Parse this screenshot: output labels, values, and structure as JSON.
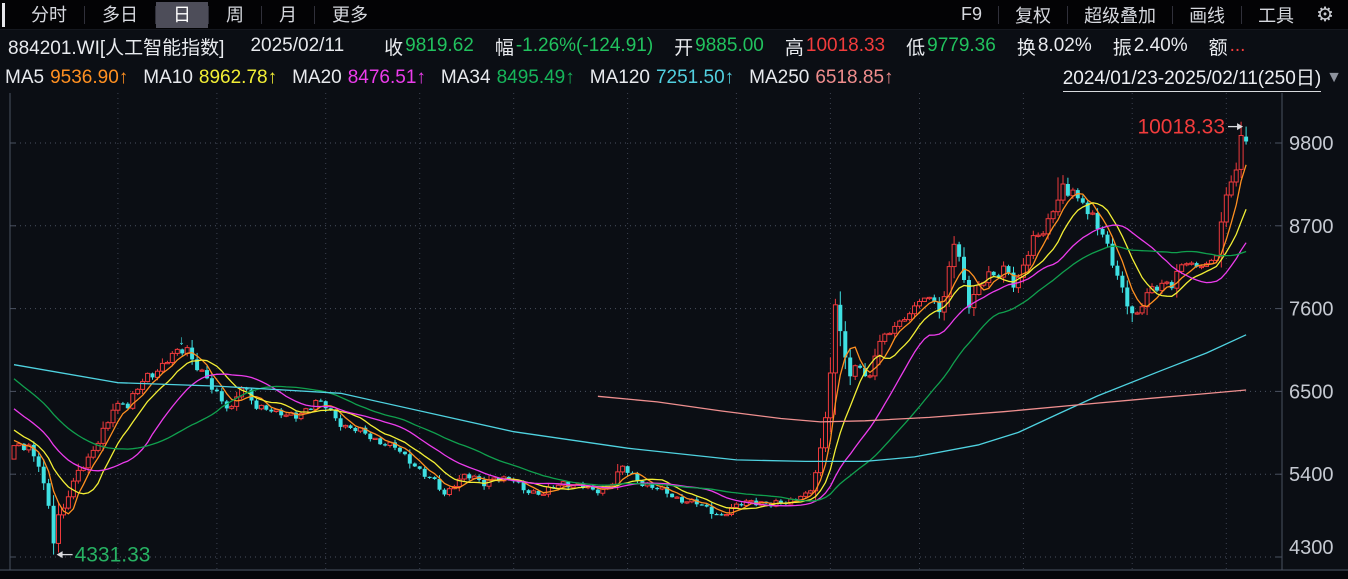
{
  "toolbar": {
    "left_tabs": [
      {
        "label": "分时",
        "active": false
      },
      {
        "label": "多日",
        "active": false
      },
      {
        "label": "日",
        "active": true
      },
      {
        "label": "周",
        "active": false
      },
      {
        "label": "月",
        "active": false
      },
      {
        "label": "更多",
        "active": false
      }
    ],
    "right_items": [
      "F9",
      "复权",
      "超级叠加",
      "画线",
      "工具"
    ],
    "gear_icon": "⚙"
  },
  "info_bar": {
    "symbol": "884201.WI[人工智能指数]",
    "date": "2025/02/11",
    "fields": [
      {
        "label": "收",
        "value": "9819.62",
        "color": "#21c25e"
      },
      {
        "label": "幅",
        "value": "-1.26%(-124.91)",
        "color": "#21c25e"
      },
      {
        "label": "开",
        "value": "9885.00",
        "color": "#21c25e"
      },
      {
        "label": "高",
        "value": "10018.33",
        "color": "#f23c3c"
      },
      {
        "label": "低",
        "value": "9779.36",
        "color": "#21c25e"
      },
      {
        "label": "换",
        "value": "8.02%",
        "color": "#e8eaee"
      },
      {
        "label": "振",
        "value": "2.40%",
        "color": "#e8eaee"
      },
      {
        "label": "额",
        "value": "...",
        "color": "#f23c3c"
      }
    ]
  },
  "ma_bar": {
    "items": [
      {
        "label": "MA5",
        "value": "9536.90",
        "arrow": "↑",
        "color": "#ff9021"
      },
      {
        "label": "MA10",
        "value": "8962.78",
        "arrow": "↑",
        "color": "#f2ee35"
      },
      {
        "label": "MA20",
        "value": "8476.51",
        "arrow": "↑",
        "color": "#ec3cec"
      },
      {
        "label": "MA34",
        "value": "8495.49",
        "arrow": "↑",
        "color": "#16b45a"
      },
      {
        "label": "MA120",
        "value": "7251.50",
        "arrow": "↑",
        "color": "#52d0e0"
      },
      {
        "label": "MA250",
        "value": "6518.85",
        "arrow": "↑",
        "color": "#f08d8d"
      }
    ],
    "range_label": "2024/01/23-2025/02/11(250日)",
    "dropdown_icon": "▼"
  },
  "chart_data": {
    "type": "candlestick",
    "symbol": "884201.WI",
    "title": "人工智能指数 日K",
    "period_days": 250,
    "date_range": [
      "2024/01/23",
      "2025/02/11"
    ],
    "last_day": {
      "open": 9885.0,
      "high": 10018.33,
      "low": 9779.36,
      "close": 9819.62,
      "change_pct": -1.26,
      "change": -124.91
    },
    "y_axis": {
      "ticks": [
        9800,
        8700,
        7600,
        6500,
        5400,
        4300
      ],
      "grid": "dotted"
    },
    "annotations": {
      "high": {
        "text": "10018.33",
        "value": 10018.33,
        "day": 249,
        "color": "#f23c3c"
      },
      "low": {
        "text": "4331.33",
        "value": 4331.33,
        "day": 8,
        "color": "#27b263"
      }
    },
    "signal_marker": {
      "day": 34,
      "glyph": "↓",
      "color": "#3fe0e2"
    },
    "month_gridline_days": [
      21,
      41,
      63,
      82,
      101,
      124,
      146,
      165,
      183,
      204,
      226,
      245
    ],
    "colors": {
      "up": "#ee3a3c",
      "down": "#3fe0e2",
      "bg": "#0b0e14",
      "grid_h": "#49505f",
      "grid_v": "#3c4250",
      "axis": "#4a5160",
      "tick_label": "#c6cad2",
      "arrow": "#d9dade"
    },
    "ma_computed": [
      {
        "name": "MA5",
        "period": 5,
        "color": "#ff9021"
      },
      {
        "name": "MA10",
        "period": 10,
        "color": "#f2ee35"
      },
      {
        "name": "MA20",
        "period": 20,
        "color": "#ec3cec"
      },
      {
        "name": "MA34",
        "period": 34,
        "color": "#10a04e"
      }
    ],
    "ma_anchor_lines": [
      {
        "name": "MA120",
        "color": "#4fd2e0",
        "points": [
          [
            0,
            6855
          ],
          [
            21,
            6615
          ],
          [
            41,
            6570
          ],
          [
            66,
            6475
          ],
          [
            101,
            5965
          ],
          [
            124,
            5745
          ],
          [
            146,
            5590
          ],
          [
            160,
            5570
          ],
          [
            172,
            5570
          ],
          [
            182,
            5630
          ],
          [
            195,
            5790
          ],
          [
            203,
            5955
          ],
          [
            211,
            6200
          ],
          [
            219,
            6440
          ],
          [
            232,
            6780
          ],
          [
            241,
            7010
          ],
          [
            249,
            7251.5
          ]
        ]
      },
      {
        "name": "MA250",
        "color": "#ef8f8f",
        "points": [
          [
            118,
            6435
          ],
          [
            130,
            6360
          ],
          [
            143,
            6240
          ],
          [
            155,
            6140
          ],
          [
            163,
            6095
          ],
          [
            172,
            6110
          ],
          [
            185,
            6155
          ],
          [
            200,
            6230
          ],
          [
            215,
            6320
          ],
          [
            230,
            6410
          ],
          [
            240,
            6465
          ],
          [
            249,
            6518.85
          ]
        ]
      }
    ],
    "close_anchors": [
      [
        0,
        5780
      ],
      [
        2,
        5720
      ],
      [
        3,
        5760
      ],
      [
        4,
        5620
      ],
      [
        5,
        5500
      ],
      [
        6,
        5280
      ],
      [
        7,
        4980
      ],
      [
        8,
        4480
      ],
      [
        9,
        4860
      ],
      [
        10,
        4950
      ],
      [
        11,
        5120
      ],
      [
        12,
        5300
      ],
      [
        13,
        5480
      ],
      [
        15,
        5600
      ],
      [
        17,
        5800
      ],
      [
        19,
        6100
      ],
      [
        20,
        6300
      ],
      [
        22,
        6380
      ],
      [
        23,
        6280
      ],
      [
        25,
        6520
      ],
      [
        27,
        6720
      ],
      [
        29,
        6800
      ],
      [
        31,
        6900
      ],
      [
        33,
        7000
      ],
      [
        35,
        7090
      ],
      [
        36,
        6950
      ],
      [
        38,
        6750
      ],
      [
        40,
        6520
      ],
      [
        42,
        6380
      ],
      [
        44,
        6300
      ],
      [
        45,
        6450
      ],
      [
        46,
        6550
      ],
      [
        47,
        6450
      ],
      [
        49,
        6280
      ],
      [
        51,
        6320
      ],
      [
        53,
        6220
      ],
      [
        55,
        6150
      ],
      [
        57,
        6180
      ],
      [
        59,
        6280
      ],
      [
        61,
        6350
      ],
      [
        63,
        6280
      ],
      [
        65,
        6150
      ],
      [
        67,
        6050
      ],
      [
        69,
        5980
      ],
      [
        71,
        5920
      ],
      [
        73,
        5870
      ],
      [
        75,
        5820
      ],
      [
        77,
        5740
      ],
      [
        79,
        5620
      ],
      [
        81,
        5540
      ],
      [
        83,
        5400
      ],
      [
        85,
        5280
      ],
      [
        87,
        5120
      ],
      [
        89,
        5300
      ],
      [
        91,
        5380
      ],
      [
        93,
        5320
      ],
      [
        95,
        5280
      ],
      [
        97,
        5380
      ],
      [
        99,
        5320
      ],
      [
        101,
        5300
      ],
      [
        103,
        5220
      ],
      [
        105,
        5170
      ],
      [
        107,
        5120
      ],
      [
        109,
        5220
      ],
      [
        111,
        5300
      ],
      [
        113,
        5270
      ],
      [
        115,
        5220
      ],
      [
        117,
        5170
      ],
      [
        119,
        5220
      ],
      [
        121,
        5300
      ],
      [
        123,
        5470
      ],
      [
        125,
        5380
      ],
      [
        127,
        5300
      ],
      [
        129,
        5220
      ],
      [
        131,
        5170
      ],
      [
        133,
        5120
      ],
      [
        135,
        5070
      ],
      [
        137,
        5020
      ],
      [
        139,
        4970
      ],
      [
        141,
        4920
      ],
      [
        143,
        4860
      ],
      [
        145,
        4920
      ],
      [
        147,
        5000
      ],
      [
        149,
        5070
      ],
      [
        151,
        5020
      ],
      [
        153,
        4970
      ],
      [
        155,
        5020
      ],
      [
        157,
        5070
      ],
      [
        159,
        5120
      ],
      [
        161,
        5180
      ],
      [
        162,
        5420
      ],
      [
        163,
        5750
      ],
      [
        164,
        6150
      ],
      [
        165,
        6745
      ],
      [
        166,
        7650
      ],
      [
        167,
        7300
      ],
      [
        168,
        6950
      ],
      [
        169,
        6700
      ],
      [
        170,
        6870
      ],
      [
        171,
        6820
      ],
      [
        172,
        6720
      ],
      [
        173,
        6780
      ],
      [
        174,
        6950
      ],
      [
        175,
        7120
      ],
      [
        176,
        7260
      ],
      [
        177,
        7210
      ],
      [
        178,
        7360
      ],
      [
        179,
        7510
      ],
      [
        180,
        7460
      ],
      [
        181,
        7560
      ],
      [
        182,
        7660
      ],
      [
        183,
        7610
      ],
      [
        184,
        7710
      ],
      [
        185,
        7760
      ],
      [
        186,
        7660
      ],
      [
        187,
        7620
      ],
      [
        188,
        7820
      ],
      [
        189,
        8120
      ],
      [
        190,
        8460
      ],
      [
        191,
        8250
      ],
      [
        192,
        7900
      ],
      [
        193,
        7650
      ],
      [
        194,
        7820
      ],
      [
        195,
        7920
      ],
      [
        196,
        8020
      ],
      [
        197,
        8070
      ],
      [
        198,
        7970
      ],
      [
        199,
        8020
      ],
      [
        200,
        8120
      ],
      [
        201,
        8070
      ],
      [
        202,
        7970
      ],
      [
        203,
        8030
      ],
      [
        204,
        8180
      ],
      [
        205,
        8330
      ],
      [
        206,
        8480
      ],
      [
        207,
        8530
      ],
      [
        208,
        8630
      ],
      [
        209,
        8780
      ],
      [
        210,
        8950
      ],
      [
        211,
        9120
      ],
      [
        212,
        9200
      ],
      [
        213,
        9080
      ],
      [
        214,
        9150
      ],
      [
        215,
        8980
      ],
      [
        216,
        9050
      ],
      [
        217,
        8920
      ],
      [
        218,
        8870
      ],
      [
        219,
        8720
      ],
      [
        220,
        8570
      ],
      [
        221,
        8370
      ],
      [
        222,
        8170
      ],
      [
        223,
        8020
      ],
      [
        224,
        7870
      ],
      [
        225,
        7720
      ],
      [
        226,
        7560
      ],
      [
        227,
        7520
      ],
      [
        228,
        7640
      ],
      [
        229,
        7740
      ],
      [
        230,
        7840
      ],
      [
        231,
        7890
      ],
      [
        232,
        7940
      ],
      [
        233,
        7990
      ],
      [
        234,
        7940
      ],
      [
        235,
        8040
      ],
      [
        236,
        8140
      ],
      [
        237,
        8190
      ],
      [
        238,
        8140
      ],
      [
        239,
        8190
      ],
      [
        240,
        8240
      ],
      [
        241,
        8190
      ],
      [
        242,
        8240
      ],
      [
        243,
        8300
      ],
      [
        244,
        8750
      ],
      [
        245,
        9109
      ],
      [
        246,
        9282
      ],
      [
        247,
        9441
      ],
      [
        248,
        9900
      ],
      [
        249,
        9819.62
      ]
    ],
    "ohlc_overrides": {
      "0": {
        "open": 5600
      },
      "8": {
        "low": 4331.33
      },
      "166": {
        "high": 7730
      },
      "190": {
        "high": 8563
      },
      "211": {
        "high": 9343
      },
      "226": {
        "low": 7420
      },
      "248": {
        "open": 9450
      },
      "249": {
        "open": 9885.0,
        "high": 10018.33,
        "low": 9779.36,
        "close": 9819.62
      }
    },
    "no_jitter_day_ranges": [
      [
        5,
        10
      ],
      [
        160,
        169
      ],
      [
        242,
        249
      ]
    ]
  }
}
